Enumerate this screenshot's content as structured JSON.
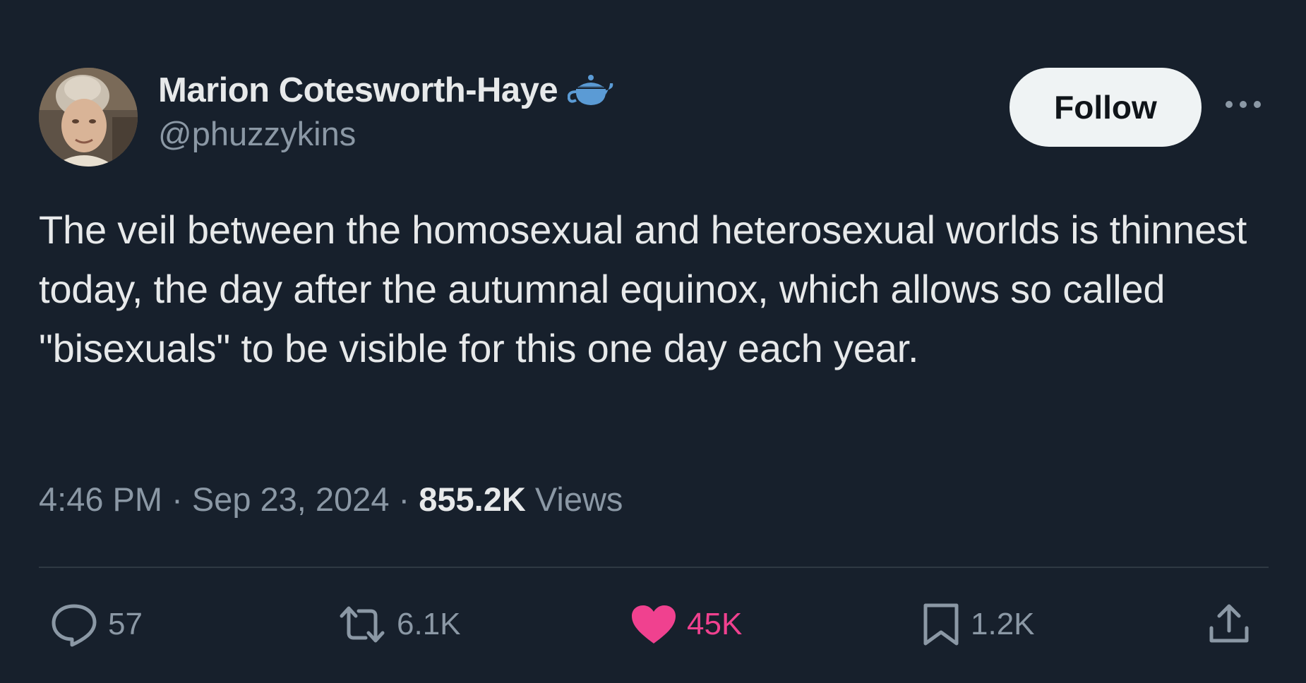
{
  "user": {
    "display_name": "Marion Cotesworth-Haye",
    "handle": "@phuzzykins",
    "badge_icon": "teapot-icon"
  },
  "follow_button": {
    "label": "Follow"
  },
  "tweet": {
    "text": "The veil between the homosexual and heterosexual worlds is thinnest today, the day after the autumnal equinox, which allows so called \"bisexuals\" to be visible for this one day each year."
  },
  "meta": {
    "time": "4:46 PM",
    "separator": "·",
    "date": "Sep 23, 2024",
    "views_count": "855.2K",
    "views_label": "Views"
  },
  "actions": {
    "replies": "57",
    "reposts": "6.1K",
    "likes": "45K",
    "bookmarks": "1.2K"
  },
  "colors": {
    "background": "#17202c",
    "text_primary": "#e7e9ea",
    "text_secondary": "#8b98a5",
    "like_active": "#f0418f",
    "teapot": "#5b9bd5",
    "follow_bg": "#eff3f4"
  }
}
